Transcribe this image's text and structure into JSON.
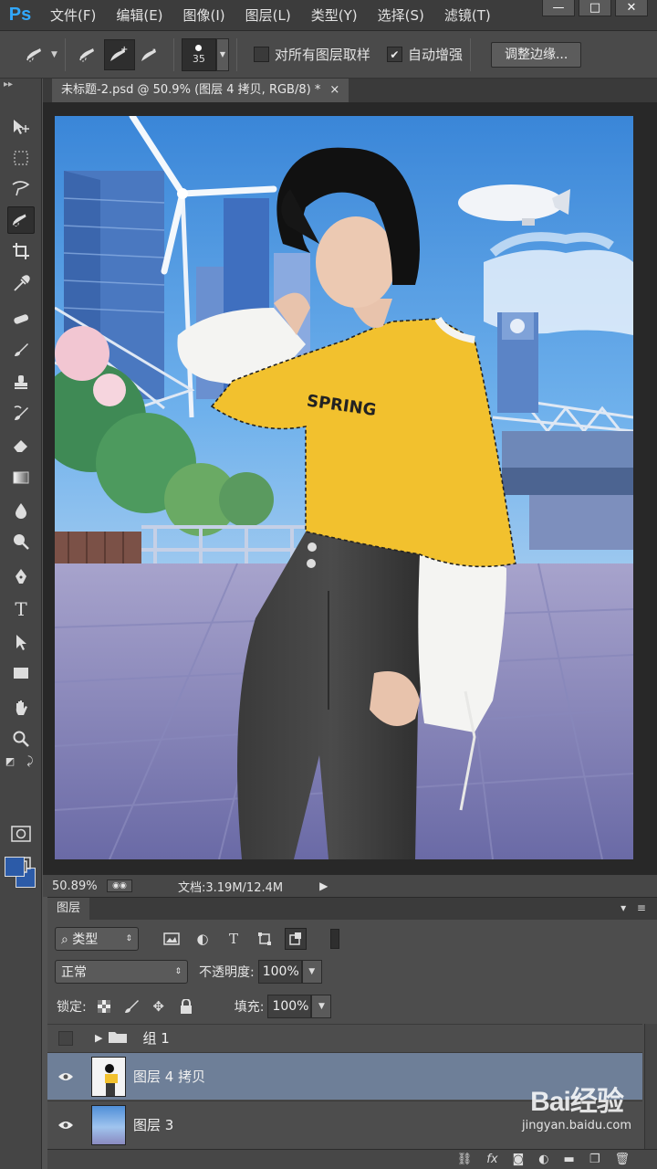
{
  "app": {
    "logo": "Ps"
  },
  "menu": [
    "文件(F)",
    "编辑(E)",
    "图像(I)",
    "图层(L)",
    "类型(Y)",
    "选择(S)",
    "滤镜(T)"
  ],
  "window_controls": [
    "—",
    "□",
    "✕"
  ],
  "options": {
    "brush_size": "35",
    "sample_all_layers_label": "对所有图层取样",
    "sample_all_layers_checked": false,
    "auto_enhance_label": "自动增强",
    "auto_enhance_checked": true,
    "refine_edge_label": "调整边缘..."
  },
  "document": {
    "tab_title": "未标题-2.psd @ 50.9% (图层 4 拷贝, RGB/8) *",
    "close_glyph": "×"
  },
  "status": {
    "zoom": "50.89%",
    "doc_info": "文档:3.19M/12.4M"
  },
  "colors": {
    "foreground": "#2c5ba8",
    "background": "#2c5ba8",
    "selected_layer": "#6e7f98",
    "shirt": "#f2c12e"
  },
  "artwork": {
    "shirt_text": "SPRING"
  },
  "layers_panel": {
    "tab_label": "图层",
    "filter_label": "⌕ 类型",
    "blend_mode": "正常",
    "opacity_label": "不透明度:",
    "opacity_value": "100%",
    "lock_label": "锁定:",
    "fill_label": "填充:",
    "fill_value": "100%",
    "layers": [
      {
        "name": "组 1",
        "type": "group",
        "visible": false,
        "selected": false
      },
      {
        "name": "图层 4 拷贝",
        "type": "layer",
        "visible": true,
        "selected": true
      },
      {
        "name": "图层 3",
        "type": "layer",
        "visible": true,
        "selected": false
      }
    ],
    "footer_icons": [
      "link-icon",
      "fx-icon",
      "mask-icon",
      "adjustment-icon",
      "folder-icon",
      "new-layer-icon",
      "trash-icon"
    ]
  },
  "watermark": {
    "logo": "Bai经验",
    "url": "jingyan.baidu.com"
  }
}
